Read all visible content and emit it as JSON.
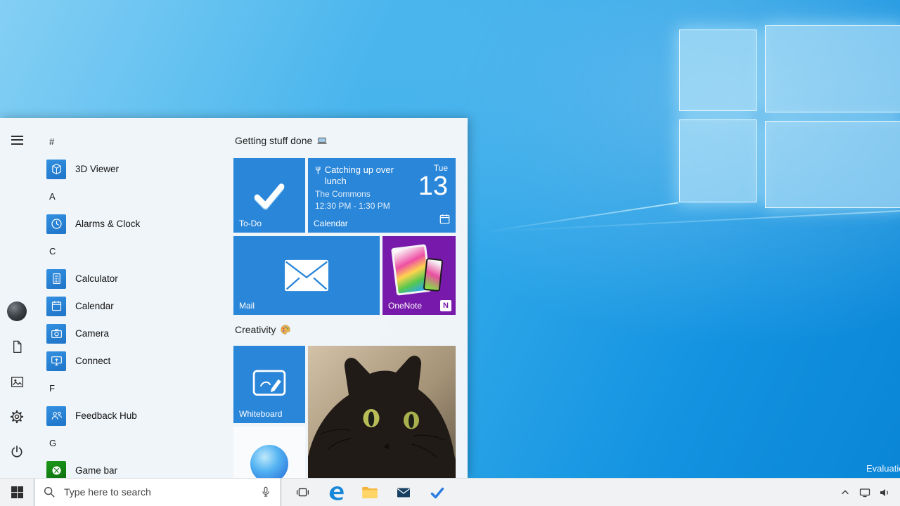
{
  "desktop": {
    "watermark": "Evaluation"
  },
  "colors": {
    "tile_blue": "#2a86d8",
    "onenote_purple": "#7719aa",
    "gamebar_green": "#107c10",
    "accent": "#0078d7"
  },
  "start_menu": {
    "app_list": [
      {
        "type": "section",
        "label": "#"
      },
      {
        "type": "app",
        "label": "3D Viewer",
        "icon": "cube-icon"
      },
      {
        "type": "section",
        "label": "A"
      },
      {
        "type": "app",
        "label": "Alarms & Clock",
        "icon": "clock-icon"
      },
      {
        "type": "section",
        "label": "C"
      },
      {
        "type": "app",
        "label": "Calculator",
        "icon": "calculator-icon"
      },
      {
        "type": "app",
        "label": "Calendar",
        "icon": "calendar-icon"
      },
      {
        "type": "app",
        "label": "Camera",
        "icon": "camera-icon"
      },
      {
        "type": "app",
        "label": "Connect",
        "icon": "connect-icon"
      },
      {
        "type": "section",
        "label": "F"
      },
      {
        "type": "app",
        "label": "Feedback Hub",
        "icon": "feedback-icon"
      },
      {
        "type": "section",
        "label": "G"
      },
      {
        "type": "app",
        "label": "Game bar",
        "icon": "gamebar-icon"
      }
    ],
    "groups": {
      "group1": "Getting stuff done",
      "group1_icon": "laptop-emoji",
      "group2": "Creativity",
      "group2_icon": "palette-emoji"
    },
    "tiles": {
      "todo_label": "To-Do",
      "calendar": {
        "event_title": "Catching up over lunch",
        "event_location": "The Commons",
        "event_time": "12:30 PM - 1:30 PM",
        "day_name": "Tue",
        "day_number": "13",
        "label": "Calendar"
      },
      "mail_label": "Mail",
      "onenote_label": "OneNote",
      "onenote_badge": "N",
      "whiteboard_label": "Whiteboard"
    }
  },
  "taskbar": {
    "search_placeholder": "Type here to search"
  }
}
